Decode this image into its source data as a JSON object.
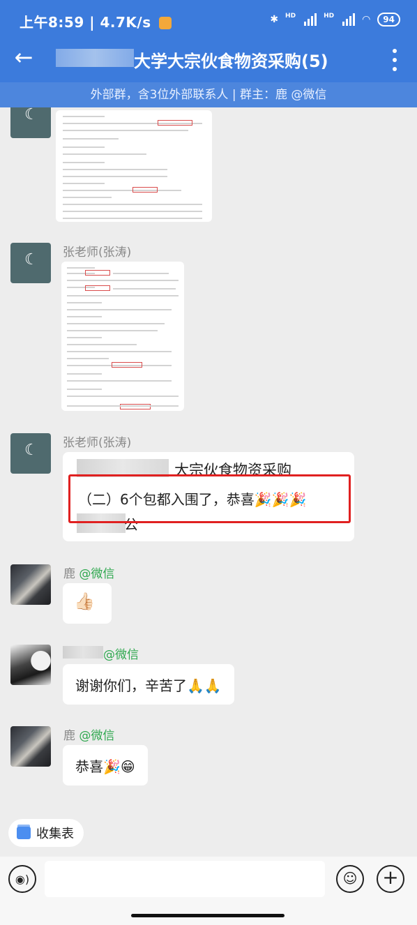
{
  "status": {
    "time": "上午8:59",
    "speed": "4.7K/s",
    "battery": "94",
    "hd1": "HD",
    "hd2": "HD"
  },
  "header": {
    "title": "大学大宗伙食物资采购(5)",
    "subtitle": "外部群，含3位外部联系人 | 群主：鹿 @微信",
    "back_icon": "back-arrow-icon",
    "more_icon": "more-vertical-icon"
  },
  "messages": [
    {
      "sender": "",
      "type": "image"
    },
    {
      "sender": "张老师(张涛)",
      "type": "image"
    },
    {
      "sender": "张老师(张涛)",
      "type": "text",
      "line1": "大宗伙食物资采购",
      "line2": "（二）6个包都入围了，恭喜🎉🎉🎉",
      "line3": "公"
    },
    {
      "sender": "鹿",
      "sender_tag": "@微信",
      "type": "text",
      "text": "👍🏻"
    },
    {
      "sender": "",
      "sender_tag": "@微信",
      "type": "text",
      "text": "谢谢你们，辛苦了🙏🙏"
    },
    {
      "sender": "鹿",
      "sender_tag": "@微信",
      "type": "text",
      "text": "恭喜🎉😁"
    }
  ],
  "collect": {
    "label": "收集表"
  },
  "input": {
    "placeholder": ""
  },
  "colors": {
    "accent": "#3c7bdc",
    "tag": "#2fa84f"
  }
}
